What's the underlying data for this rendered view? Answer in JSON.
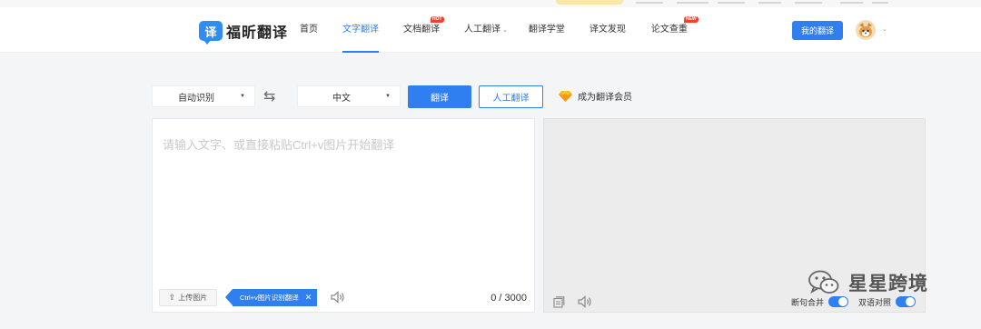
{
  "header": {
    "logo_mark": "译",
    "logo_text": "福昕翻译",
    "nav": [
      {
        "label": "首页",
        "active": false
      },
      {
        "label": "文字翻译",
        "active": true
      },
      {
        "label": "文档翻译",
        "active": false,
        "badge": "HOT"
      },
      {
        "label": "人工翻译",
        "active": false,
        "dropdown": true
      },
      {
        "label": "翻译学堂",
        "active": false
      },
      {
        "label": "译文发现",
        "active": false
      },
      {
        "label": "论文查重",
        "active": false,
        "badge": "NEW"
      }
    ],
    "my_translation_button": "我的翻译"
  },
  "toolbar": {
    "source_lang": "自动识别",
    "target_lang": "中文",
    "translate_button": "翻译",
    "human_translate_button": "人工翻译",
    "vip_link": "成为翻译会员"
  },
  "input_panel": {
    "placeholder": "请输入文字、或直接粘贴Ctrl+v图片开始翻译",
    "upload_button": "上传图片",
    "tip": "Ctrl+v图片识别翻译",
    "char_count": "0 / 3000"
  },
  "output_panel": {
    "merge_label": "断句合并",
    "merge_on": true,
    "bilingual_label": "双语对照",
    "bilingual_on": true
  },
  "watermark": {
    "text": "星星跨境"
  },
  "colors": {
    "accent": "#2f7ff1",
    "badge": "#f5402c"
  }
}
